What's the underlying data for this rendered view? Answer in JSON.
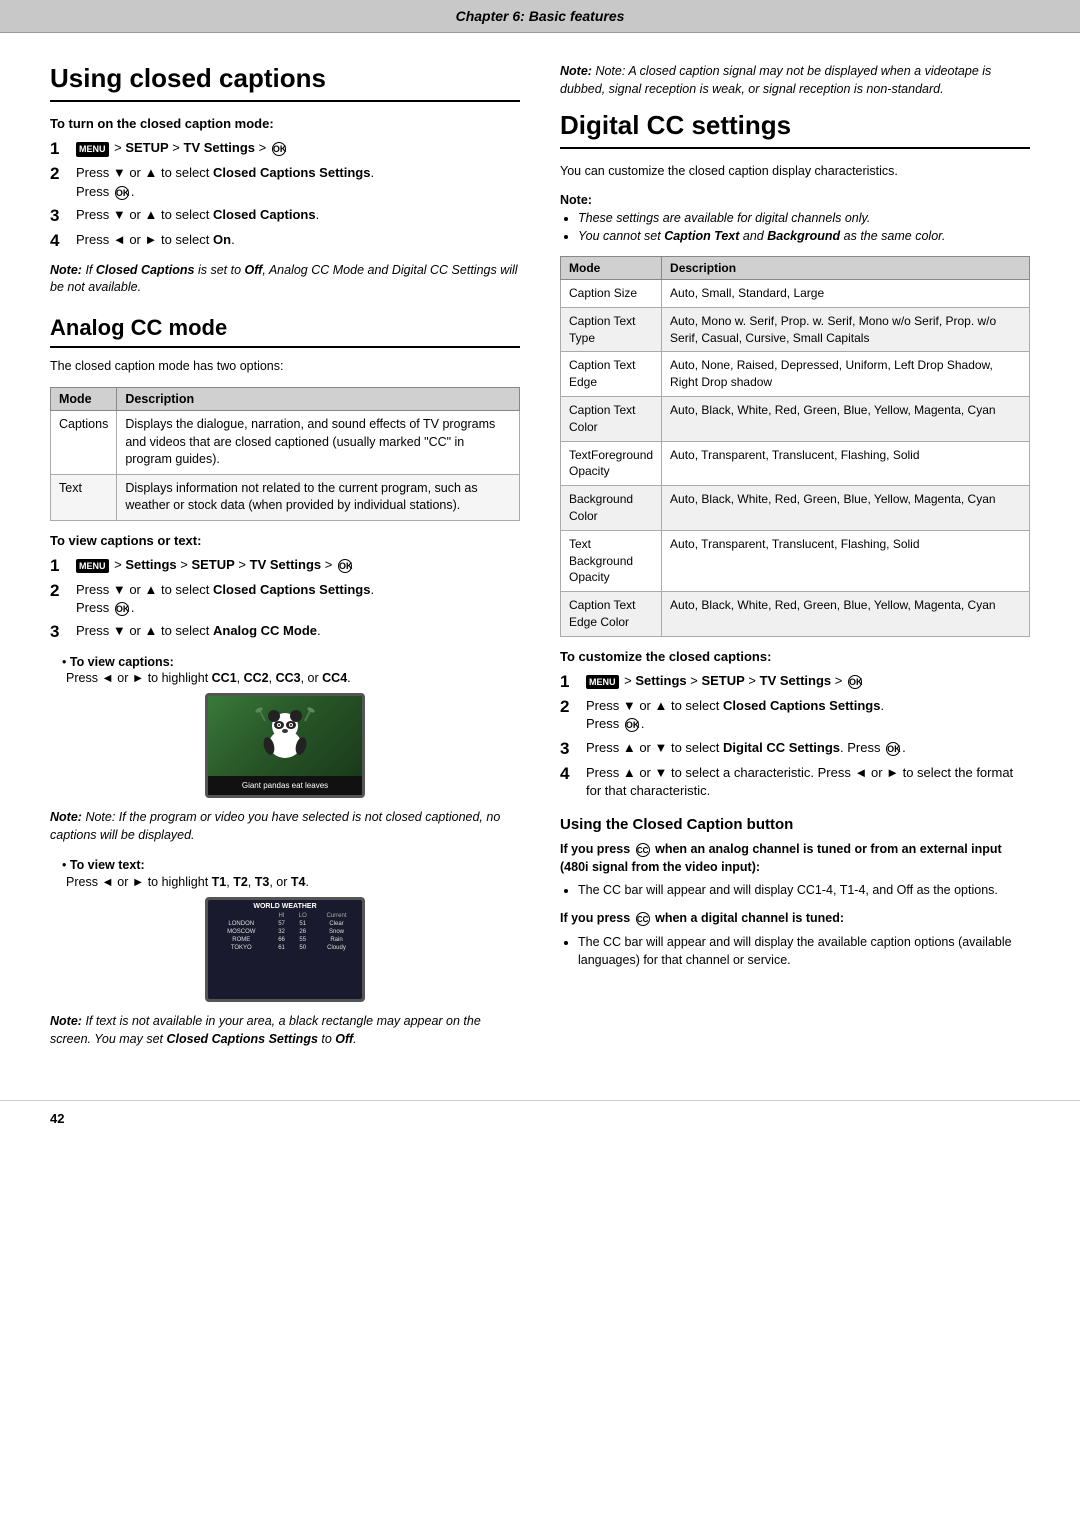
{
  "chapter_header": "Chapter 6: Basic features",
  "left": {
    "section_title": "Using closed captions",
    "turn_on_label": "To turn on the closed caption mode:",
    "steps_turn_on": [
      {
        "num": "1",
        "content": "MENU > SETUP > TV Settings > OK"
      },
      {
        "num": "2",
        "content": "Press ▼ or ▲ to select Closed Captions Settings. Press OK."
      },
      {
        "num": "3",
        "content": "Press ▼ or ▲ to select Closed Captions."
      },
      {
        "num": "4",
        "content": "Press ◄ or ► to select On."
      }
    ],
    "note_turn_on": "Note: If Closed Captions is set to Off, Analog CC Mode and Digital CC Settings will be not available.",
    "analog_title": "Analog CC mode",
    "analog_desc": "The closed caption mode has two options:",
    "analog_table": {
      "headers": [
        "Mode",
        "Description"
      ],
      "rows": [
        [
          "Captions",
          "Displays the dialogue, narration, and sound effects of TV programs and videos that are closed captioned (usually marked \"CC\" in program guides)."
        ],
        [
          "Text",
          "Displays information not related to the current program, such as weather or stock data (when provided by individual stations)."
        ]
      ]
    },
    "view_label": "To view captions or text:",
    "steps_view": [
      {
        "num": "1",
        "content": "MENU > Settings > SETUP > TV Settings > OK"
      },
      {
        "num": "2",
        "content": "Press ▼ or ▲ to select Closed Captions Settings. Press OK."
      },
      {
        "num": "3",
        "content": "Press ▼ or ▲ to select Analog CC Mode."
      }
    ],
    "to_view_captions": "To view captions:",
    "captions_instruction": "Press ◄ or ► to highlight CC1, CC2, CC3, or CC4.",
    "tv_caption_text": "Giant pandas eat leaves",
    "note_panda": "Note: If the program or video you have selected is not closed captioned, no captions will be displayed.",
    "to_view_text": "To view text:",
    "text_instruction": "Press ◄ or ► to highlight T1, T2, T3, or T4.",
    "note_weather": "Note: If text is not available in your area, a black rectangle may appear on the screen. You may set Closed Captions Settings to Off.",
    "weather_header": "WORLD WEATHER",
    "weather_data": [
      [
        "LONDON",
        "57",
        "51",
        "Clear"
      ],
      [
        "MOSCOW",
        "32",
        "26",
        "Snow"
      ],
      [
        "ROME",
        "66",
        "55",
        "Rain"
      ],
      [
        "TOKYO",
        "61",
        "50",
        "Cloudy"
      ]
    ]
  },
  "right": {
    "note_top": "Note: A closed caption signal may not be displayed when a videotape is dubbed, signal reception is weak, or signal reception is non-standard.",
    "digital_title": "Digital CC settings",
    "digital_desc": "You can customize the closed caption display characteristics.",
    "digital_note_label": "Note:",
    "digital_notes": [
      "These settings are available for digital channels only.",
      "You cannot set Caption Text and Background as the same color."
    ],
    "digital_table": {
      "headers": [
        "Mode",
        "Description"
      ],
      "rows": [
        [
          "Caption Size",
          "Auto, Small, Standard, Large"
        ],
        [
          "Caption Text Type",
          "Auto, Mono w. Serif, Prop. w. Serif, Mono w/o Serif, Prop. w/o Serif, Casual, Cursive, Small Capitals"
        ],
        [
          "Caption Text Edge",
          "Auto, None, Raised, Depressed, Uniform, Left Drop Shadow, Right Drop shadow"
        ],
        [
          "Caption Text Color",
          "Auto, Black, White, Red, Green, Blue, Yellow, Magenta, Cyan"
        ],
        [
          "TextForeground Opacity",
          "Auto, Transparent, Translucent, Flashing, Solid"
        ],
        [
          "Background Color",
          "Auto, Black, White, Red, Green, Blue, Yellow, Magenta, Cyan"
        ],
        [
          "Text Background Opacity",
          "Auto, Transparent, Translucent, Flashing, Solid"
        ],
        [
          "Caption Text Edge Color",
          "Auto, Black, White, Red, Green, Blue, Yellow, Magenta, Cyan"
        ]
      ]
    },
    "customize_label": "To customize the closed captions:",
    "steps_customize": [
      {
        "num": "1",
        "content": "MENU > Settings > SETUP > TV Settings > OK"
      },
      {
        "num": "2",
        "content": "Press ▼ or ▲ to select Closed Captions Settings. Press OK."
      },
      {
        "num": "3",
        "content": "Press ▲ or ▼ to select Digital CC Settings. Press OK."
      },
      {
        "num": "4",
        "content": "Press ▲ or ▼ to select a characteristic. Press ◄ or ► to select the format for that characteristic."
      }
    ],
    "using_cc_btn_title": "Using the Closed Caption button",
    "cc_btn_bold_label": "If you press CC when an analog channel is tuned or from an external input (480i signal from the video input):",
    "cc_btn_analog_bullets": [
      "The CC bar will appear and will display CC1-4, T1-4, and Off as the options."
    ],
    "cc_btn_digital_label": "If you press CC when a digital channel is tuned:",
    "cc_btn_digital_bullets": [
      "The CC bar will appear and will display the available caption options (available languages) for that channel or service."
    ]
  },
  "page_number": "42"
}
